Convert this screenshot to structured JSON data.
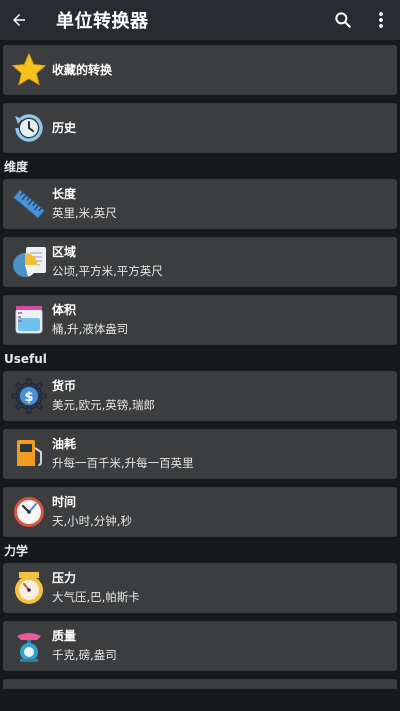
{
  "appbar": {
    "title": "单位转换器",
    "icons": [
      "back-arrow-icon",
      "search-icon",
      "more-vert-icon"
    ]
  },
  "top_items": [
    {
      "label": "收藏的转换",
      "icon": "star-icon"
    },
    {
      "label": "历史",
      "icon": "history-icon"
    }
  ],
  "sections": [
    {
      "title": "维度",
      "items": [
        {
          "label": "长度",
          "units": "英里,米,英尺",
          "icon": "ruler-icon"
        },
        {
          "label": "区域",
          "units": "公顷,平方米,平方英尺",
          "icon": "area-chart-icon"
        },
        {
          "label": "体积",
          "units": "桶,升,液体盎司",
          "icon": "beaker-icon"
        }
      ]
    },
    {
      "title": "Useful",
      "items": [
        {
          "label": "货币",
          "units": "美元,欧元,英镑,瑞郎",
          "icon": "currency-gear-icon"
        },
        {
          "label": "油耗",
          "units": "升每一百千米,升每一百英里",
          "icon": "fuel-pump-icon"
        },
        {
          "label": "时间",
          "units": "天,小时,分钟,秒",
          "icon": "clock-icon"
        }
      ]
    },
    {
      "title": "力学",
      "items": [
        {
          "label": "压力",
          "units": "大气压,巴,帕斯卡",
          "icon": "pressure-gauge-icon"
        },
        {
          "label": "质量",
          "units": "千克,磅,盎司",
          "icon": "scale-icon"
        }
      ]
    }
  ]
}
